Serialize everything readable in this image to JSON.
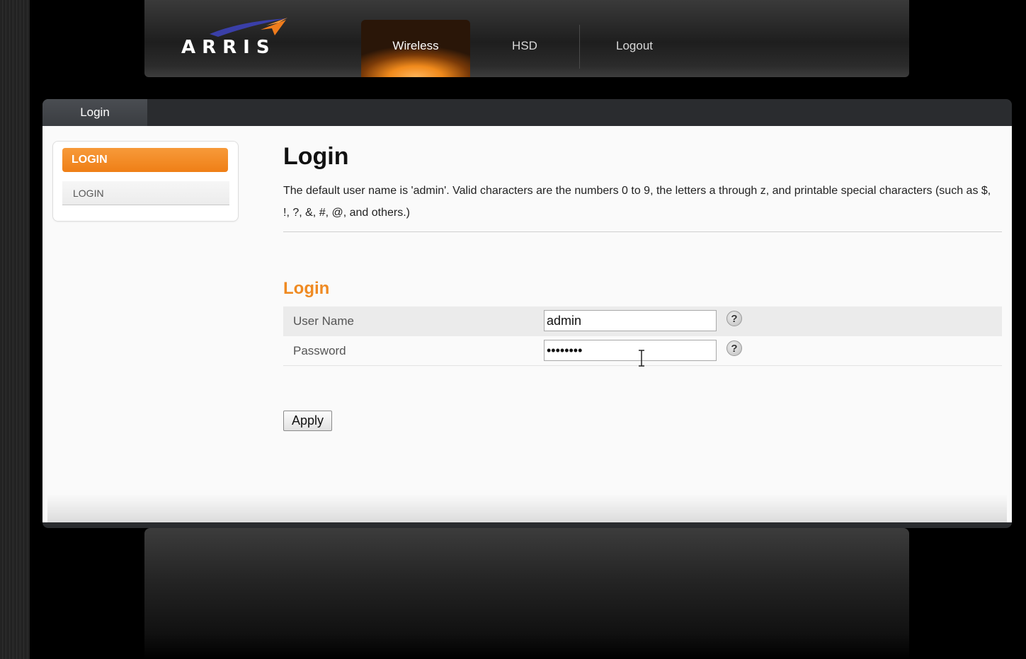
{
  "header": {
    "logo_text": "ARRIS",
    "tabs": [
      {
        "label": "Wireless",
        "active": true
      },
      {
        "label": "HSD",
        "active": false
      },
      {
        "label": "Logout",
        "active": false
      }
    ]
  },
  "panel": {
    "tab_label": "Login"
  },
  "sidebar": {
    "items": [
      {
        "label": "LOGIN",
        "active": true
      },
      {
        "label": "LOGIN",
        "active": false
      }
    ]
  },
  "main": {
    "title": "Login",
    "description": "The default user name is 'admin'. Valid characters are the numbers 0 to 9, the letters a through z, and printable special characters (such as $, !, ?, &, #, @, and others.)",
    "section_title": "Login",
    "fields": [
      {
        "label": "User Name",
        "value": "admin",
        "type": "text"
      },
      {
        "label": "Password",
        "value": "••••••••",
        "type": "password"
      }
    ],
    "help_label": "?",
    "apply_label": "Apply"
  },
  "colors": {
    "accent": "#ef8a22",
    "background": "#000000"
  }
}
